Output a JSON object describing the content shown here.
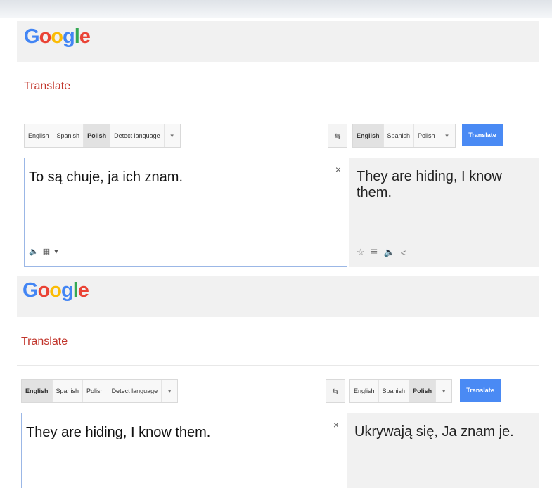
{
  "panels": [
    {
      "logo_letters": [
        "G",
        "o",
        "o",
        "g",
        "l",
        "e"
      ],
      "translate_label": "Translate",
      "source_langs": [
        {
          "label": "English",
          "active": false
        },
        {
          "label": "Spanish",
          "active": false
        },
        {
          "label": "Polish",
          "active": true
        },
        {
          "label": "Detect language",
          "active": false
        }
      ],
      "target_langs": [
        {
          "label": "English",
          "active": true
        },
        {
          "label": "Spanish",
          "active": false
        },
        {
          "label": "Polish",
          "active": false
        }
      ],
      "translate_button": "Translate",
      "source_text": "To są chuje, ja ich znam.",
      "result_text": "They are hiding, I know them."
    },
    {
      "logo_letters": [
        "G",
        "o",
        "o",
        "g",
        "l",
        "e"
      ],
      "translate_label": "Translate",
      "source_langs": [
        {
          "label": "English",
          "active": true
        },
        {
          "label": "Spanish",
          "active": false
        },
        {
          "label": "Polish",
          "active": false
        },
        {
          "label": "Detect language",
          "active": false
        }
      ],
      "target_langs": [
        {
          "label": "English",
          "active": false
        },
        {
          "label": "Spanish",
          "active": false
        },
        {
          "label": "Polish",
          "active": true
        }
      ],
      "translate_button": "Translate",
      "source_text": "They are hiding, I know them.",
      "result_text": "Ukrywają się, Ja znam je."
    }
  ],
  "glyphs": {
    "clear": "×",
    "dropdown": "▾",
    "swap": "⇆",
    "speaker": "🔈",
    "keyboard": "▦",
    "star": "☆",
    "phrasebook": "≣",
    "share": "<"
  },
  "accent": "#4a8af4",
  "translate_label_color": "#c1352b"
}
